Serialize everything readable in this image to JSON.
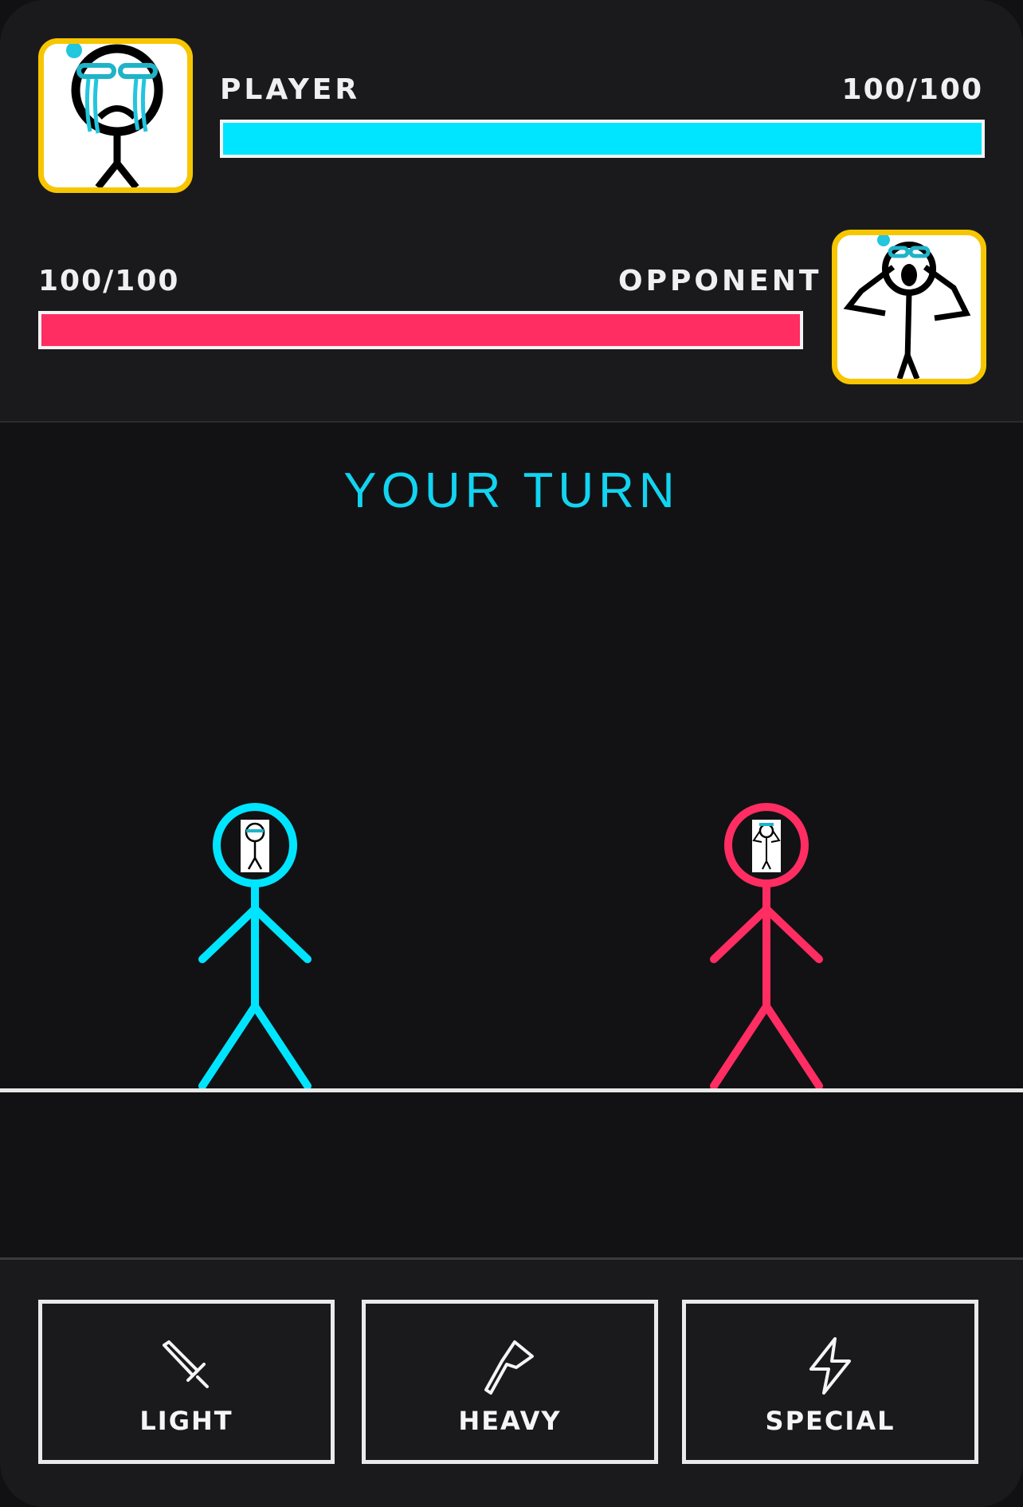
{
  "player": {
    "name": "PLAYER",
    "hp_text": "100/100",
    "hp_fraction": 1.0,
    "color": "#00e5ff",
    "avatar_icon": "crying-stickman-icon"
  },
  "opponent": {
    "name": "OPPONENT",
    "hp_text": "100/100",
    "hp_fraction": 1.0,
    "color": "#ff2d62",
    "avatar_icon": "screaming-stickman-icon"
  },
  "turn_text": "YOUR TURN",
  "turn_color": "#12d4f0",
  "actions": [
    {
      "label": "LIGHT",
      "icon": "sword-icon"
    },
    {
      "label": "HEAVY",
      "icon": "axe-icon"
    },
    {
      "label": "SPECIAL",
      "icon": "lightning-icon"
    }
  ],
  "accent_border": "#f7c600"
}
